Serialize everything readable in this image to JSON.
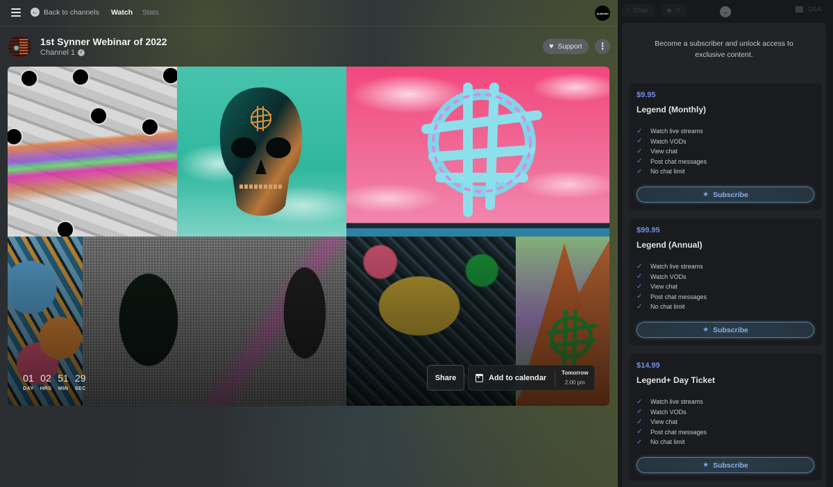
{
  "topbar": {
    "menu_icon": "hamburger-icon",
    "back_label": "Back to channels",
    "back_icon": "arrow-left-circle-icon",
    "tabs": [
      {
        "label": "Watch",
        "active": true
      },
      {
        "label": "Stats",
        "active": false
      }
    ],
    "brand_avatar_text": "Audentio"
  },
  "event": {
    "title": "1st Synner Webinar of 2022",
    "channel": "Channel 1",
    "verified_icon": "verified-check-icon",
    "support_label": "Support",
    "support_icon": "heart-icon",
    "more_icon": "more-vertical-icon"
  },
  "countdown": [
    {
      "value": "01",
      "label": "DAY"
    },
    {
      "value": "02",
      "label": "HRS"
    },
    {
      "value": "51",
      "label": "MIN"
    },
    {
      "value": "29",
      "label": "SEC"
    }
  ],
  "actions": {
    "share_label": "Share",
    "calendar_label": "Add to calendar",
    "calendar_icon": "calendar-plus-icon",
    "when_day": "Tomorrow",
    "when_time": "2:00 pm"
  },
  "sidebar": {
    "chat_label": "Chat",
    "viewers_count": "0",
    "qa_label": "Q&A",
    "collapse_icon": "chevron-down-icon",
    "promo_text": "Become a subscriber and unlock access to exclusive content.",
    "accent_color": "#6f8fe0",
    "plans": [
      {
        "price": "$9.95",
        "name": "Legend (Monthly)",
        "features": [
          "Watch live streams",
          "Watch VODs",
          "View chat",
          "Post chat messages",
          "No chat limit"
        ],
        "button_label": "Subscribe"
      },
      {
        "price": "$99.95",
        "name": "Legend (Annual)",
        "features": [
          "Watch live streams",
          "Watch VODs",
          "View chat",
          "Post chat messages",
          "No chat limit"
        ],
        "button_label": "Subscribe"
      },
      {
        "price": "$14.99",
        "name": "Legend+ Day Ticket",
        "features": [
          "Watch live streams",
          "Watch VODs",
          "View chat",
          "Post chat messages",
          "No chat limit"
        ],
        "button_label": "Subscribe"
      }
    ]
  }
}
